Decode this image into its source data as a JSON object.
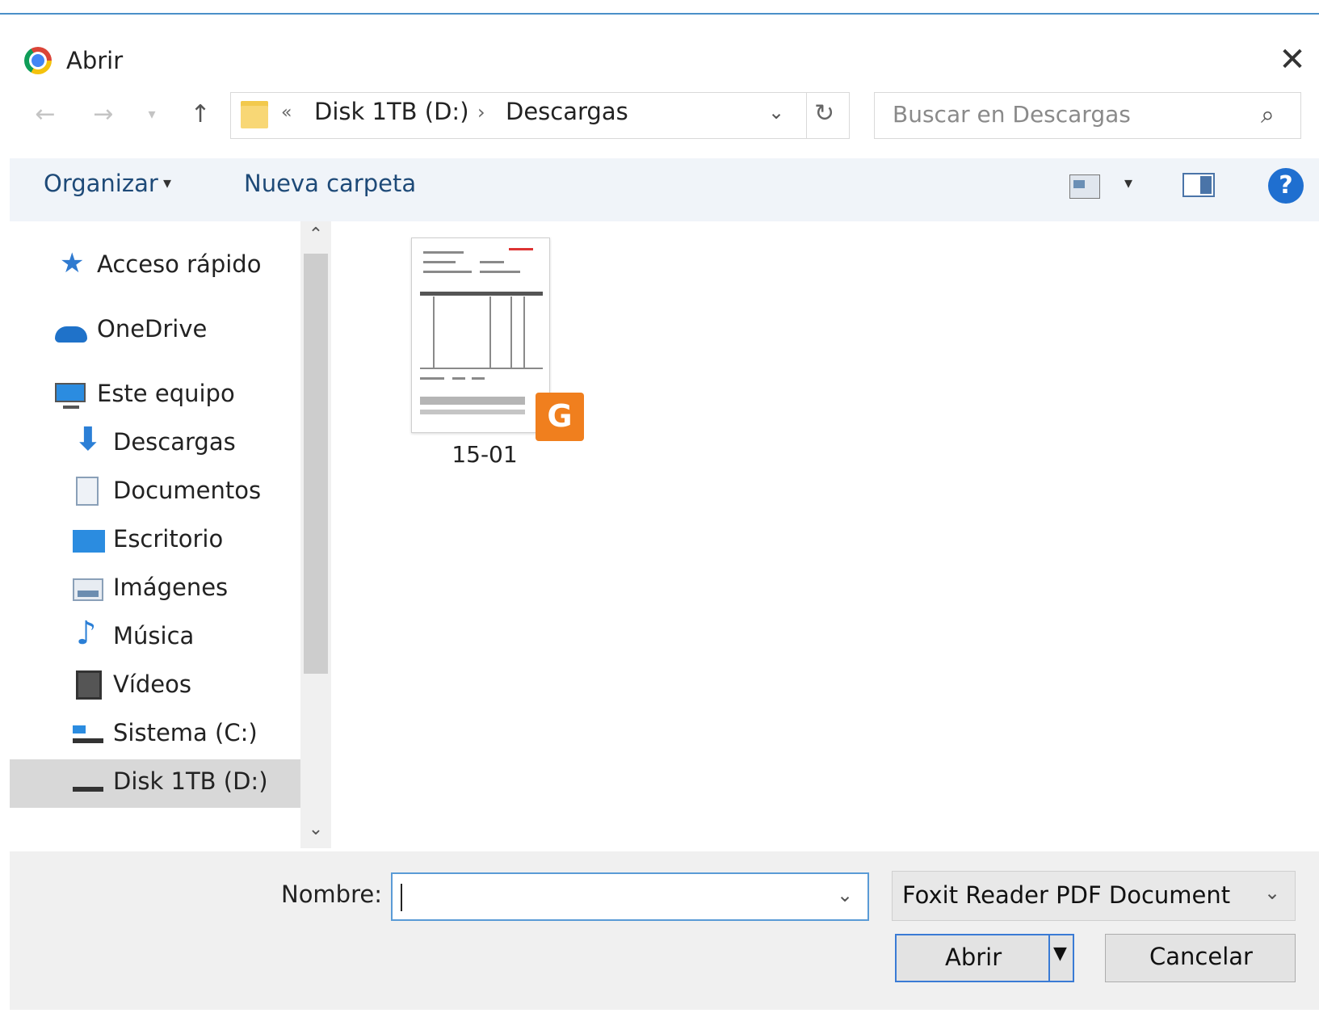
{
  "window": {
    "title": "Abrir"
  },
  "address": {
    "prefix": "«",
    "crumbs": [
      "Disk 1TB (D:)",
      "Descargas"
    ],
    "separator": "›"
  },
  "search": {
    "placeholder": "Buscar en Descargas"
  },
  "toolbar": {
    "organize": "Organizar",
    "new_folder": "Nueva carpeta"
  },
  "sidebar": {
    "items": [
      {
        "label": "Acceso rápido",
        "icon": "star-icon"
      },
      {
        "label": "OneDrive",
        "icon": "cloud-icon"
      },
      {
        "label": "Este equipo",
        "icon": "computer-icon"
      },
      {
        "label": "Descargas",
        "icon": "download-icon"
      },
      {
        "label": "Documentos",
        "icon": "document-icon"
      },
      {
        "label": "Escritorio",
        "icon": "desktop-icon"
      },
      {
        "label": "Imágenes",
        "icon": "pictures-icon"
      },
      {
        "label": "Música",
        "icon": "music-icon"
      },
      {
        "label": "Vídeos",
        "icon": "video-icon"
      },
      {
        "label": "Sistema (C:)",
        "icon": "system-drive-icon"
      },
      {
        "label": "Disk 1TB (D:)",
        "icon": "drive-icon",
        "selected": true
      }
    ]
  },
  "files": [
    {
      "name": "15-01",
      "badge_icon": "foxit-reader-icon"
    }
  ],
  "footer": {
    "name_label": "Nombre:",
    "name_value": "",
    "file_type": "Foxit Reader PDF Document",
    "open_button": "Abrir",
    "cancel_button": "Cancelar"
  },
  "colors": {
    "accent": "#1f6fd0",
    "toolbar_bg": "#f0f4f9",
    "badge": "#f07f1e"
  }
}
